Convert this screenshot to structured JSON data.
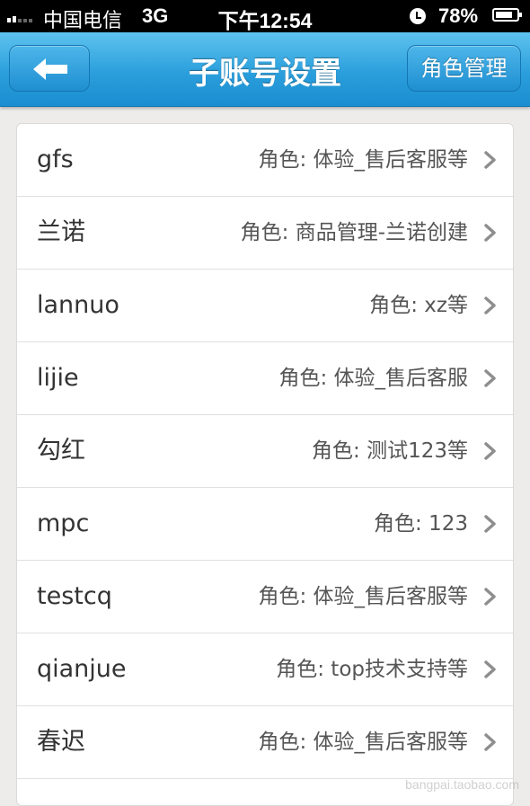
{
  "status_bar": {
    "carrier": "中国电信",
    "network": "3G",
    "time": "下午12:54",
    "battery": "78%"
  },
  "nav": {
    "title": "子账号设置",
    "role_manage_label": "角色管理"
  },
  "accounts": [
    {
      "name": "gfs",
      "role": "角色: 体验_售后客服等"
    },
    {
      "name": "兰诺",
      "role": "角色: 商品管理-兰诺创建"
    },
    {
      "name": "lannuo",
      "role": "角色: xz等"
    },
    {
      "name": "lijie",
      "role": "角色: 体验_售后客服"
    },
    {
      "name": "勾红",
      "role": "角色: 测试123等"
    },
    {
      "name": "mpc",
      "role": "角色: 123"
    },
    {
      "name": "testcq",
      "role": "角色: 体验_售后客服等"
    },
    {
      "name": "qianjue",
      "role": "角色: top技术支持等"
    },
    {
      "name": "春迟",
      "role": "角色: 体验_售后客服等"
    }
  ],
  "watermark": "bangpai.taobao.com",
  "colors": {
    "nav_top": "#5ec3ef",
    "nav_bottom": "#1a8dd0",
    "background": "#eeeceb",
    "chevron": "#8e8e8e"
  }
}
